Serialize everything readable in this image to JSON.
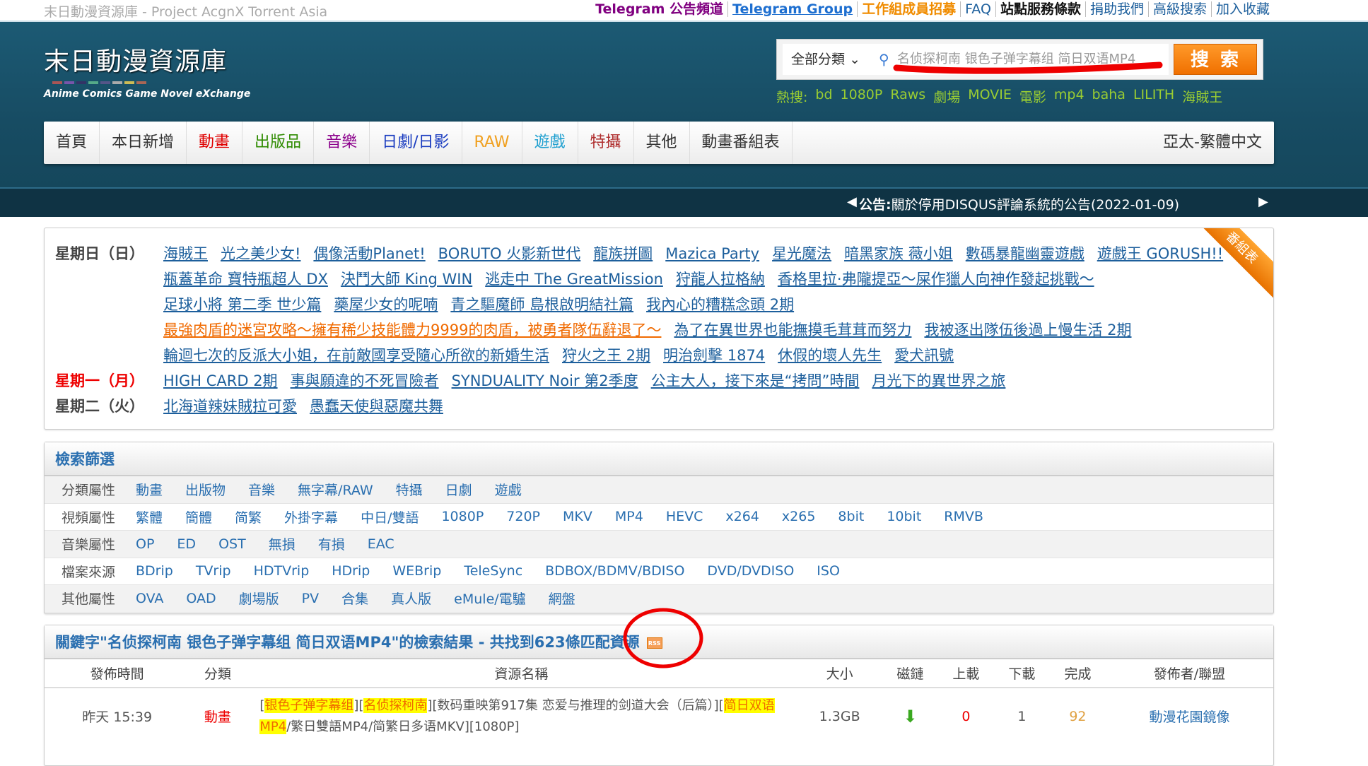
{
  "topbar": {
    "site_subtitle": "末日動漫資源庫 - Project AcgnX Torrent Asia",
    "links": [
      {
        "label": "Telegram 公告頻道",
        "color": "#800080"
      },
      {
        "label": "Telegram Group",
        "color": "#1e6fd0"
      },
      {
        "label": "工作組成員招募",
        "color": "#f08c00"
      },
      {
        "label": "FAQ",
        "color": "#1d5f9c"
      },
      {
        "label": "站點服務條款",
        "color": "#111111"
      },
      {
        "label": "捐助我們",
        "color": "#1d5f9c"
      },
      {
        "label": "高級搜索",
        "color": "#1d5f9c"
      },
      {
        "label": "加入收藏",
        "color": "#1d5f9c"
      }
    ]
  },
  "logo": {
    "title": "末日動漫資源庫",
    "subtitle": "Anime Comics Game Novel eXchange"
  },
  "search": {
    "category": "全部分類",
    "query": "名侦探柯南 银色子弹字幕组 简日双语MP4",
    "button": "搜索"
  },
  "hot": {
    "label": "熱搜:",
    "terms": [
      "bd",
      "1080P",
      "Raws",
      "劇場",
      "MOVIE",
      "電影",
      "mp4",
      "baha",
      "LILITH",
      "海賊王"
    ]
  },
  "nav": {
    "items": [
      {
        "label": "首頁",
        "color": "#333333"
      },
      {
        "label": "本日新增",
        "color": "#333333"
      },
      {
        "label": "動畫",
        "color": "#e00000"
      },
      {
        "label": "出版品",
        "color": "#2e8b00"
      },
      {
        "label": "音樂",
        "color": "#8b008b"
      },
      {
        "label": "日劇/日影",
        "color": "#1a3cc0"
      },
      {
        "label": "RAW",
        "color": "#f0a020"
      },
      {
        "label": "遊戲",
        "color": "#20a0d0"
      },
      {
        "label": "特攝",
        "color": "#b03030"
      },
      {
        "label": "其他",
        "color": "#333333"
      },
      {
        "label": "動畫番組表",
        "color": "#333333"
      }
    ],
    "language": "亞太-繁體中文"
  },
  "announcement": {
    "label": "公告:",
    "text": "關於停用DISQUS評論系統的公告(2022-01-09)"
  },
  "schedule": {
    "ribbon": "番組表",
    "days": [
      {
        "day": "星期日（日）",
        "today": false,
        "titles": [
          "海賊王",
          "光之美少女!",
          "偶像活動Planet!",
          "BORUTO 火影新世代",
          "龍族拼圖",
          "Mazica Party",
          "星光魔法",
          "暗黑家族 薇小姐",
          "數碼暴龍幽靈遊戲",
          "遊戲王 GORUSH!!",
          "瓶蓋革命 寶特瓶超人 DX",
          "決鬥大師 King WIN",
          "逃走中 The GreatMission",
          "狩龍人拉格納",
          "香格里拉·弗隴提亞～屎作獵人向神作發起挑戰～",
          "足球小將 第二季 世少篇",
          "藥屋少女的呢喃",
          "青之驅魔師 島根啟明結社篇",
          "我內心的糟糕念頭 2期",
          "最強肉盾的迷宮攻略～擁有稀少技能體力9999的肉盾，被勇者隊伍辭退了～",
          "為了在異世界也能撫摸毛茸茸而努力",
          "我被逐出隊伍後過上慢生活 2期",
          "輪迴七次的反派大小姐，在前敵國享受隨心所欲的新婚生活",
          "狩火之王 2期",
          "明治劍擊 1874",
          "休假的壞人先生",
          "愛犬訊號"
        ],
        "highlight": 19
      },
      {
        "day": "星期一（月）",
        "today": true,
        "titles": [
          "HIGH CARD 2期",
          "事與願違的不死冒險者",
          "SYNDUALITY Noir 第2季度",
          "公主大人，接下來是“拷問”時間",
          "月光下的異世界之旅"
        ]
      },
      {
        "day": "星期二（火）",
        "today": false,
        "titles": [
          "北海道辣妹賊拉可愛",
          "愚蠢天使與惡魔共舞"
        ]
      }
    ]
  },
  "filter": {
    "title": "檢索篩選",
    "rows": [
      {
        "label": "分類屬性",
        "items": [
          "動畫",
          "出版物",
          "音樂",
          "無字幕/RAW",
          "特攝",
          "日劇",
          "遊戲"
        ]
      },
      {
        "label": "視頻屬性",
        "items": [
          "繁體",
          "簡體",
          "简繁",
          "外掛字幕",
          "中日/雙語",
          "1080P",
          "720P",
          "MKV",
          "MP4",
          "HEVC",
          "x264",
          "x265",
          "8bit",
          "10bit",
          "RMVB"
        ]
      },
      {
        "label": "音樂屬性",
        "items": [
          "OP",
          "ED",
          "OST",
          "無損",
          "有損",
          "EAC"
        ]
      },
      {
        "label": "檔案來源",
        "items": [
          "BDrip",
          "TVrip",
          "HDTVrip",
          "HDrip",
          "WEBrip",
          "TeleSync",
          "BDBOX/BDMV/BDISO",
          "DVD/DVDISO",
          "ISO"
        ]
      },
      {
        "label": "其他屬性",
        "items": [
          "OVA",
          "OAD",
          "劇場版",
          "PV",
          "合集",
          "真人版",
          "eMule/電驢",
          "網盤"
        ]
      }
    ]
  },
  "results": {
    "title": "關鍵字\"名侦探柯南 银色子弹字幕组 简日双语MP4\"的檢索結果 - 共找到623條匹配資源",
    "rss": "RSS",
    "columns": [
      "發佈時間",
      "分類",
      "資源名稱",
      "大小",
      "磁鏈",
      "上載",
      "下載",
      "完成",
      "發佈者/聯盟"
    ],
    "rows": [
      {
        "time": "昨天 15:39",
        "category": "動畫",
        "name_parts": [
          {
            "t": "[",
            "h": false
          },
          {
            "t": "银色子弹字幕组",
            "h": true
          },
          {
            "t": "][",
            "h": false
          },
          {
            "t": "名侦探柯南",
            "h": true
          },
          {
            "t": "][数码重映第917集 恋爱与推理的剑道大会（后篇）][",
            "h": false
          },
          {
            "t": "简日双语MP4",
            "h": true
          },
          {
            "t": "/繁日雙語MP4/简繁日多语MKV][1080P]",
            "h": false
          }
        ],
        "size": "1.3GB",
        "seeders": "0",
        "leechers": "1",
        "completed": "92",
        "publisher": "動漫花園鏡像"
      }
    ]
  },
  "colors": {
    "header": "#1c5a74",
    "accent": "#f07000",
    "link": "#1d5f9c"
  }
}
